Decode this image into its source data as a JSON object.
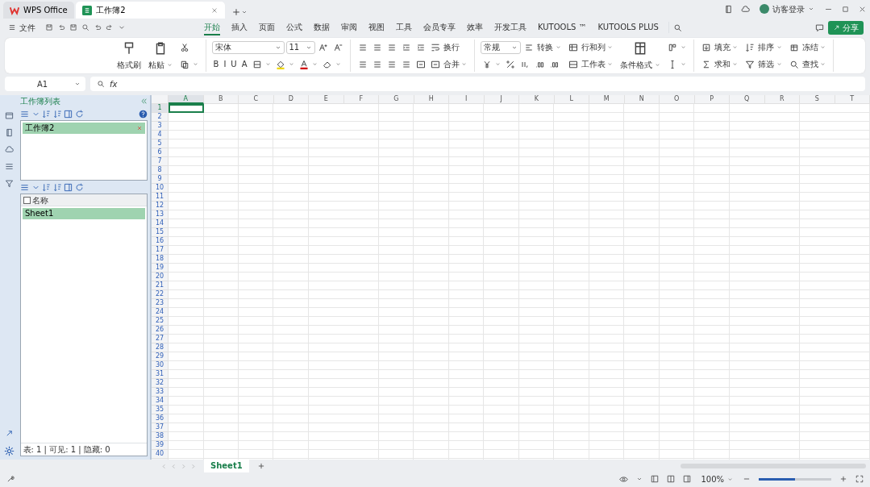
{
  "tabs": [
    {
      "label": "WPS Office",
      "kind": "home",
      "selected": false
    },
    {
      "label": "工作簿2",
      "kind": "sheet",
      "selected": true
    }
  ],
  "account": {
    "label": "访客登录"
  },
  "menu": {
    "file": "文件",
    "share": "分享",
    "ribbon_tabs": [
      {
        "label": "开始",
        "selected": true
      },
      {
        "label": "插入",
        "selected": false
      },
      {
        "label": "页面",
        "selected": false
      },
      {
        "label": "公式",
        "selected": false
      },
      {
        "label": "数据",
        "selected": false
      },
      {
        "label": "审阅",
        "selected": false
      },
      {
        "label": "视图",
        "selected": false
      },
      {
        "label": "工具",
        "selected": false
      },
      {
        "label": "会员专享",
        "selected": false
      },
      {
        "label": "效率",
        "selected": false
      },
      {
        "label": "开发工具",
        "selected": false
      },
      {
        "label": "KUTOOLS ™",
        "selected": false
      },
      {
        "label": "KUTOOLS PLUS",
        "selected": false
      }
    ]
  },
  "ribbon": {
    "groups": [
      {
        "columns": [
          {
            "big": {
              "kind": "brush",
              "label": "格式刷"
            }
          },
          {
            "big": {
              "kind": "paste",
              "label": "粘贴",
              "dropdown": true
            }
          },
          {
            "rows": [
              {
                "items": [
                  {
                    "kind": "scissors"
                  }
                ]
              },
              {
                "items": [
                  {
                    "kind": "copy",
                    "dropdown": true
                  }
                ]
              }
            ]
          }
        ]
      },
      {
        "columns": [
          {
            "rows": [
              {
                "items": [
                  {
                    "kind": "font",
                    "label": "宋体"
                  },
                  {
                    "kind": "size",
                    "label": "11"
                  },
                  {
                    "kind": "grow"
                  },
                  {
                    "kind": "shrink"
                  }
                ]
              },
              {
                "items": [
                  {
                    "kind": "text",
                    "label": "B"
                  },
                  {
                    "kind": "text",
                    "label": "I"
                  },
                  {
                    "kind": "text",
                    "label": "U"
                  },
                  {
                    "kind": "text",
                    "label": "A"
                  },
                  {
                    "kind": "border",
                    "dropdown": true
                  },
                  {
                    "kind": "fill",
                    "dropdown": true
                  },
                  {
                    "kind": "fontcolor",
                    "dropdown": true
                  },
                  {
                    "kind": "eraser",
                    "dropdown": true
                  }
                ]
              }
            ]
          }
        ]
      },
      {
        "columns": [
          {
            "rows": [
              {
                "items": [
                  {
                    "kind": "lines"
                  },
                  {
                    "kind": "lines"
                  },
                  {
                    "kind": "lines"
                  },
                  {
                    "kind": "indent"
                  },
                  {
                    "kind": "indent"
                  },
                  {
                    "kind": "wrap",
                    "label": "换行"
                  }
                ]
              },
              {
                "items": [
                  {
                    "kind": "lines"
                  },
                  {
                    "kind": "lines"
                  },
                  {
                    "kind": "lines"
                  },
                  {
                    "kind": "lines"
                  },
                  {
                    "kind": "merge"
                  },
                  {
                    "kind": "merge",
                    "label": "合并",
                    "dropdown": true
                  }
                ]
              }
            ]
          }
        ]
      },
      {
        "columns": [
          {
            "rows": [
              {
                "items": [
                  {
                    "kind": "number",
                    "label": "常规"
                  },
                  {
                    "kind": "convert",
                    "label": "转换",
                    "dropdown": true
                  }
                ]
              },
              {
                "items": [
                  {
                    "kind": "currency",
                    "dropdown": true
                  },
                  {
                    "kind": "percent"
                  },
                  {
                    "kind": "thousands"
                  },
                  {
                    "kind": "decimal"
                  },
                  {
                    "kind": "decimal"
                  }
                ]
              }
            ]
          },
          {
            "rows": [
              {
                "items": [
                  {
                    "kind": "rowcol",
                    "label": "行和列",
                    "dropdown": true
                  }
                ]
              },
              {
                "items": [
                  {
                    "kind": "sheet",
                    "label": "工作表",
                    "dropdown": true
                  }
                ]
              }
            ]
          },
          {
            "big": {
              "kind": "cond",
              "label": "条件格式",
              "dropdown": true
            }
          },
          {
            "rows": [
              {
                "items": [
                  {
                    "kind": "style",
                    "dropdown": true
                  }
                ]
              },
              {
                "items": [
                  {
                    "kind": "cursor",
                    "dropdown": true
                  }
                ]
              }
            ]
          }
        ]
      },
      {
        "columns": [
          {
            "rows": [
              {
                "items": [
                  {
                    "kind": "filldown",
                    "label": "填充",
                    "dropdown": true
                  }
                ]
              },
              {
                "items": [
                  {
                    "kind": "sigma",
                    "label": "求和",
                    "dropdown": true
                  }
                ]
              }
            ]
          },
          {
            "rows": [
              {
                "items": [
                  {
                    "kind": "sort",
                    "label": "排序",
                    "dropdown": true
                  }
                ]
              },
              {
                "items": [
                  {
                    "kind": "filter",
                    "label": "筛选",
                    "dropdown": true
                  }
                ]
              }
            ]
          },
          {
            "rows": [
              {
                "items": [
                  {
                    "kind": "freeze",
                    "label": "冻结",
                    "dropdown": true
                  }
                ]
              },
              {
                "items": [
                  {
                    "kind": "find",
                    "label": "查找",
                    "dropdown": true
                  }
                ]
              }
            ]
          }
        ]
      }
    ]
  },
  "formula_bar": {
    "cell": "A1",
    "fx": "fx"
  },
  "navigation_pane": {
    "title": "工作簿列表",
    "workbooks": [
      {
        "label": "工作簿2",
        "selected": true
      }
    ],
    "select_all": {
      "checked": false
    },
    "sheet_header": "名称",
    "sheets": [
      {
        "label": "Sheet1",
        "selected": true
      }
    ],
    "footer": "表: 1 | 可见: 1 | 隐藏: 0"
  },
  "grid": {
    "columns": [
      {
        "label": "A",
        "selected": true
      },
      {
        "label": "B",
        "selected": false
      },
      {
        "label": "C",
        "selected": false
      },
      {
        "label": "D",
        "selected": false
      },
      {
        "label": "E",
        "selected": false
      },
      {
        "label": "F",
        "selected": false
      },
      {
        "label": "G",
        "selected": false
      },
      {
        "label": "H",
        "selected": false
      },
      {
        "label": "I",
        "selected": false
      },
      {
        "label": "J",
        "selected": false
      },
      {
        "label": "K",
        "selected": false
      },
      {
        "label": "L",
        "selected": false
      },
      {
        "label": "M",
        "selected": false
      },
      {
        "label": "N",
        "selected": false
      },
      {
        "label": "O",
        "selected": false
      },
      {
        "label": "P",
        "selected": false
      },
      {
        "label": "Q",
        "selected": false
      },
      {
        "label": "R",
        "selected": false
      },
      {
        "label": "S",
        "selected": false
      },
      {
        "label": "T",
        "selected": false
      }
    ],
    "rows": [
      "1",
      "2",
      "3",
      "4",
      "5",
      "6",
      "7",
      "8",
      "9",
      "10",
      "11",
      "12",
      "13",
      "14",
      "15",
      "16",
      "17",
      "18",
      "19",
      "20",
      "21",
      "22",
      "23",
      "24",
      "25",
      "26",
      "27",
      "28",
      "29",
      "30",
      "31",
      "32",
      "33",
      "34",
      "35",
      "36",
      "37",
      "38",
      "39",
      "40"
    ]
  },
  "sheet_tabs": [
    {
      "label": "Sheet1",
      "selected": true
    }
  ],
  "status_bar": {
    "zoom": "100%",
    "zoom_slider": {
      "level": 0.5
    }
  }
}
